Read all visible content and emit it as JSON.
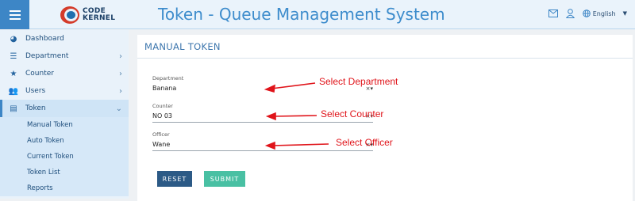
{
  "header": {
    "logo_text_1": "CODE",
    "logo_text_2": "KERNEL",
    "title": "Token - Queue Management System",
    "language": "English"
  },
  "sidebar": {
    "items": [
      {
        "label": "Dashboard",
        "icon": "dashboard-icon"
      },
      {
        "label": "Department",
        "icon": "list-icon"
      },
      {
        "label": "Counter",
        "icon": "star-icon"
      },
      {
        "label": "Users",
        "icon": "users-icon"
      },
      {
        "label": "Token",
        "icon": "id-card-icon"
      }
    ],
    "token_sub": [
      "Manual Token",
      "Auto Token",
      "Current Token",
      "Token List",
      "Reports"
    ]
  },
  "panel": {
    "title": "MANUAL TOKEN",
    "department": {
      "label": "Department",
      "value": "Banana"
    },
    "counter": {
      "label": "Counter",
      "value": "NO 03"
    },
    "officer": {
      "label": "Officer",
      "value": "Wane"
    },
    "reset_label": "RESET",
    "submit_label": "SUBMIT"
  },
  "annotations": {
    "department": "Select Department",
    "counter": "Select Counter",
    "officer": "Select Officer"
  },
  "colors": {
    "accent": "#3d86c6",
    "annotation": "#e0141a",
    "reset": "#2c5a86",
    "submit": "#49c0a3"
  }
}
